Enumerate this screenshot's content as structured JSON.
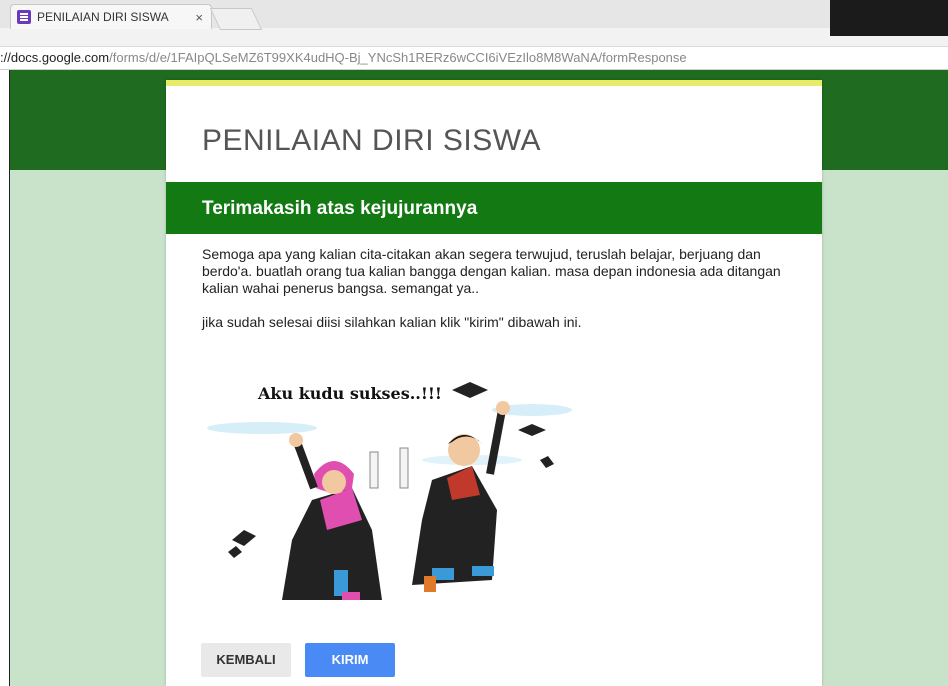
{
  "browser": {
    "tab_title": "PENILAIAN DIRI SISWA",
    "tab_close": "×",
    "url_host": "://docs.google.com",
    "url_path": "/forms/d/e/1FAIpQLSeMZ6T99XK4udHQ-Bj_YNcSh1RERz6wCCI6iVEzIlo8M8WaNA/formResponse"
  },
  "form": {
    "title": "PENILAIAN DIRI SISWA",
    "section_title": "Terimakasih atas kejujurannya",
    "description": "Semoga apa yang kalian cita-citakan akan segera terwujud, teruslah belajar, berjuang dan berdo'a. buatlah orang tua kalian bangga dengan kalian. masa depan indonesia ada ditangan kalian wahai penerus bangsa. semangat ya..",
    "note": "jika sudah selesai diisi silahkan kalian klik \"kirim\" dibawah ini.",
    "image_caption": "Aku kudu sukses..!!!",
    "back_label": "KEMBALI",
    "submit_label": "KIRIM"
  },
  "colors": {
    "banner": "#1f6b1f",
    "section_header": "#137a13",
    "accent": "#e8ea6a",
    "submit": "#4a8af4"
  },
  "icons": [
    "forms-icon",
    "close-icon"
  ]
}
